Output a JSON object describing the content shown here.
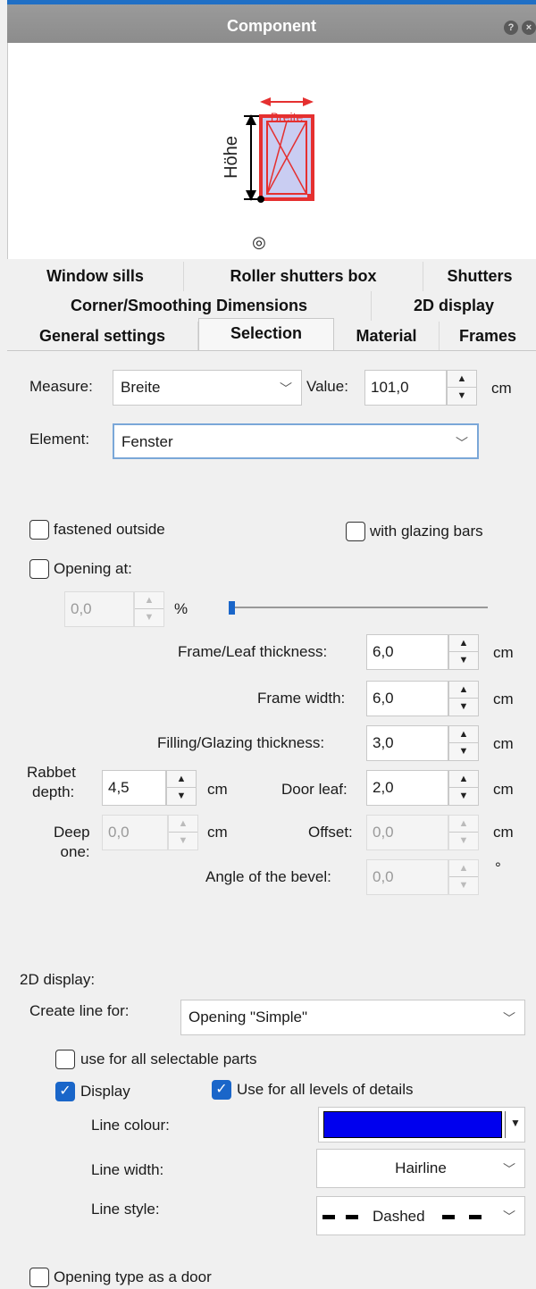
{
  "window": {
    "title": "Component",
    "help_icon": "?",
    "close_icon": "×"
  },
  "preview": {
    "width_label": "Breite",
    "height_label": "Höhe",
    "symbol": "◎"
  },
  "tabs": {
    "row1": [
      "Window sills",
      "Roller shutters box",
      "Shutters"
    ],
    "row2": [
      "Corner/Smoothing Dimensions",
      "2D display"
    ],
    "row3": [
      "General settings",
      "Selection",
      "Material",
      "Frames"
    ],
    "active": "Selection"
  },
  "measure": {
    "label": "Measure:",
    "value": "Breite"
  },
  "value_field": {
    "label": "Value:",
    "value": "101,0",
    "unit": "cm"
  },
  "element": {
    "label": "Element:",
    "value": "Fenster"
  },
  "checks": {
    "fastened_outside": "fastened outside",
    "with_glazing_bars": "with glazing bars",
    "opening_at": "Opening at:"
  },
  "opening": {
    "value": "0,0",
    "unit": "%",
    "slider_fraction": 0.0
  },
  "frame_leaf_thickness": {
    "label": "Frame/Leaf thickness:",
    "value": "6,0",
    "unit": "cm"
  },
  "frame_width": {
    "label": "Frame width:",
    "value": "6,0",
    "unit": "cm"
  },
  "filling_thickness": {
    "label": "Filling/Glazing thickness:",
    "value": "3,0",
    "unit": "cm"
  },
  "rabbet_depth": {
    "label_line1": "Rabbet",
    "label_line2": "depth:",
    "value": "4,5",
    "unit": "cm"
  },
  "door_leaf": {
    "label": "Door leaf:",
    "value": "2,0",
    "unit": "cm"
  },
  "deep_one": {
    "label_line1": "Deep",
    "label_line2": "one:",
    "value": "0,0",
    "unit": "cm"
  },
  "offset": {
    "label": "Offset:",
    "value": "0,0",
    "unit": "cm"
  },
  "bevel": {
    "label": "Angle of the bevel:",
    "value": "0,0",
    "unit": "°"
  },
  "display2d": {
    "section_label": "2D display:",
    "create_line_label": "Create line for:",
    "create_line_value": "Opening \"Simple\"",
    "use_all_parts": "use for all selectable parts",
    "display": "Display",
    "display_checked": true,
    "use_all_levels": "Use for all levels of details",
    "use_all_levels_checked": true,
    "line_colour_label": "Line colour:",
    "line_colour": "#0000ee",
    "line_width_label": "Line width:",
    "line_width_value": "Hairline",
    "line_style_label": "Line style:",
    "line_style_value": "Dashed"
  },
  "door_opening": {
    "label": "Opening type as a door"
  }
}
